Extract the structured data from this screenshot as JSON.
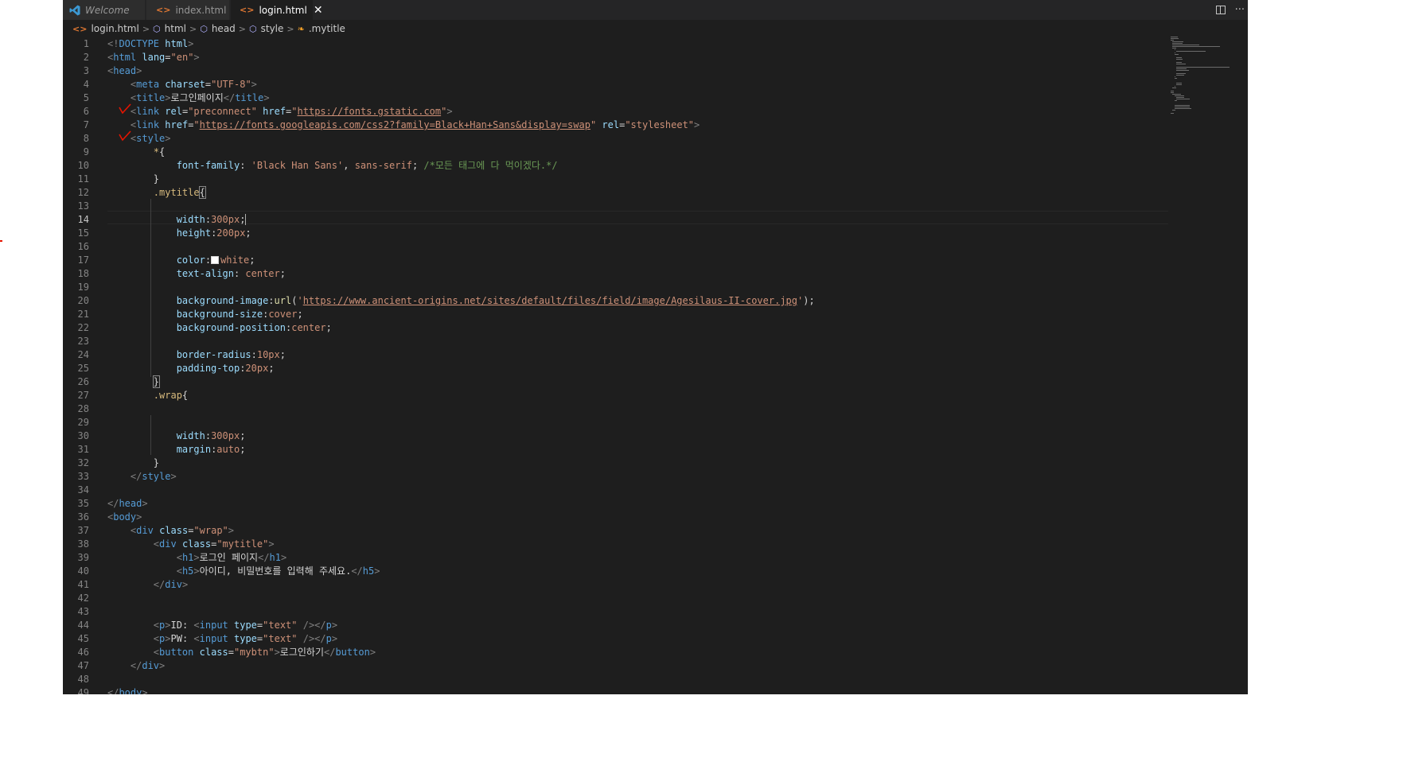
{
  "tabs": [
    {
      "label": "Welcome",
      "icon": "vscode-logo-icon",
      "active": false,
      "italic": true
    },
    {
      "label": "index.html",
      "icon": "html-file-icon",
      "active": false,
      "italic": false
    },
    {
      "label": "login.html",
      "icon": "html-file-icon",
      "active": true,
      "italic": false,
      "close": "✕"
    }
  ],
  "tab_actions": {
    "more": "···"
  },
  "breadcrumb": [
    "login.html",
    "html",
    "head",
    "style",
    ".mytitle"
  ],
  "colors": {
    "editor_bg": "#1e1e1e",
    "tab_bg": "#2d2d2d",
    "tag": "#569cd6",
    "attr": "#9cdcfe",
    "string": "#ce9178",
    "selector": "#d7ba7d",
    "comment": "#6a9955",
    "line_number": "#858585",
    "annotation_red": "#e51400"
  },
  "editor": {
    "active_line": 14,
    "annotated_lines": [
      6,
      8
    ],
    "lines": [
      [
        [
          "pun",
          "<!"
        ],
        [
          "tag",
          "DOCTYPE"
        ],
        [
          "text",
          " "
        ],
        [
          "attr",
          "html"
        ],
        [
          "pun",
          ">"
        ]
      ],
      [
        [
          "pun",
          "<"
        ],
        [
          "tag",
          "html"
        ],
        [
          "text",
          " "
        ],
        [
          "attr",
          "lang"
        ],
        [
          "text",
          "="
        ],
        [
          "str",
          "\"en\""
        ],
        [
          "pun",
          ">"
        ]
      ],
      [
        [
          "pun",
          "<"
        ],
        [
          "tag",
          "head"
        ],
        [
          "pun",
          ">"
        ]
      ],
      [
        [
          "text",
          "    "
        ],
        [
          "pun",
          "<"
        ],
        [
          "tag",
          "meta"
        ],
        [
          "text",
          " "
        ],
        [
          "attr",
          "charset"
        ],
        [
          "text",
          "="
        ],
        [
          "str",
          "\"UTF-8\""
        ],
        [
          "pun",
          ">"
        ]
      ],
      [
        [
          "text",
          "    "
        ],
        [
          "pun",
          "<"
        ],
        [
          "tag",
          "title"
        ],
        [
          "pun",
          ">"
        ],
        [
          "text",
          "로그인페이지"
        ],
        [
          "pun",
          "</"
        ],
        [
          "tag",
          "title"
        ],
        [
          "pun",
          ">"
        ]
      ],
      [
        [
          "text",
          "    "
        ],
        [
          "pun",
          "<"
        ],
        [
          "tag",
          "link"
        ],
        [
          "text",
          " "
        ],
        [
          "attr",
          "rel"
        ],
        [
          "text",
          "="
        ],
        [
          "str",
          "\"preconnect\""
        ],
        [
          "text",
          " "
        ],
        [
          "attr",
          "href"
        ],
        [
          "text",
          "="
        ],
        [
          "str",
          "\""
        ],
        [
          "url",
          "https://fonts.gstatic.com"
        ],
        [
          "str",
          "\""
        ],
        [
          "pun",
          ">"
        ]
      ],
      [
        [
          "text",
          "    "
        ],
        [
          "pun",
          "<"
        ],
        [
          "tag",
          "link"
        ],
        [
          "text",
          " "
        ],
        [
          "attr",
          "href"
        ],
        [
          "text",
          "="
        ],
        [
          "str",
          "\""
        ],
        [
          "url",
          "https://fonts.googleapis.com/css2?family=Black+Han+Sans&display=swap"
        ],
        [
          "str",
          "\""
        ],
        [
          "text",
          " "
        ],
        [
          "attr",
          "rel"
        ],
        [
          "text",
          "="
        ],
        [
          "str",
          "\"stylesheet\""
        ],
        [
          "pun",
          ">"
        ]
      ],
      [
        [
          "text",
          "    "
        ],
        [
          "pun",
          "<"
        ],
        [
          "tag",
          "style"
        ],
        [
          "pun",
          ">"
        ]
      ],
      [
        [
          "text",
          "        "
        ],
        [
          "sel",
          "*"
        ],
        [
          "text",
          "{"
        ]
      ],
      [
        [
          "text",
          "            "
        ],
        [
          "attr",
          "font-family"
        ],
        [
          "text",
          ": "
        ],
        [
          "str",
          "'Black Han Sans'"
        ],
        [
          "text",
          ", "
        ],
        [
          "str",
          "sans-serif"
        ],
        [
          "text",
          "; "
        ],
        [
          "cmt",
          "/*모든 태그에 다 먹이겠다.*/"
        ]
      ],
      [
        [
          "text",
          "        }"
        ]
      ],
      [
        [
          "text",
          "        "
        ],
        [
          "sel",
          ".mytitle"
        ],
        [
          "brace",
          "{"
        ]
      ],
      [],
      [
        [
          "text",
          "            "
        ],
        [
          "attr",
          "width"
        ],
        [
          "text",
          ":"
        ],
        [
          "str",
          "300px"
        ],
        [
          "text",
          ";"
        ],
        [
          "caret",
          ""
        ]
      ],
      [
        [
          "text",
          "            "
        ],
        [
          "attr",
          "height"
        ],
        [
          "text",
          ":"
        ],
        [
          "str",
          "200px"
        ],
        [
          "text",
          ";"
        ]
      ],
      [],
      [
        [
          "text",
          "            "
        ],
        [
          "attr",
          "color"
        ],
        [
          "text",
          ":"
        ],
        [
          "swatch",
          ""
        ],
        [
          "str",
          "white"
        ],
        [
          "text",
          ";"
        ]
      ],
      [
        [
          "text",
          "            "
        ],
        [
          "attr",
          "text-align"
        ],
        [
          "text",
          ": "
        ],
        [
          "str",
          "center"
        ],
        [
          "text",
          ";"
        ]
      ],
      [],
      [
        [
          "text",
          "            "
        ],
        [
          "attr",
          "background-image"
        ],
        [
          "text",
          ":"
        ],
        [
          "fn",
          "url"
        ],
        [
          "text",
          "("
        ],
        [
          "str",
          "'"
        ],
        [
          "url",
          "https://www.ancient-origins.net/sites/default/files/field/image/Agesilaus-II-cover.jpg"
        ],
        [
          "str",
          "'"
        ],
        [
          "text",
          ");"
        ]
      ],
      [
        [
          "text",
          "            "
        ],
        [
          "attr",
          "background-size"
        ],
        [
          "text",
          ":"
        ],
        [
          "str",
          "cover"
        ],
        [
          "text",
          ";"
        ]
      ],
      [
        [
          "text",
          "            "
        ],
        [
          "attr",
          "background-position"
        ],
        [
          "text",
          ":"
        ],
        [
          "str",
          "center"
        ],
        [
          "text",
          ";"
        ]
      ],
      [],
      [
        [
          "text",
          "            "
        ],
        [
          "attr",
          "border-radius"
        ],
        [
          "text",
          ":"
        ],
        [
          "str",
          "10px"
        ],
        [
          "text",
          ";"
        ]
      ],
      [
        [
          "text",
          "            "
        ],
        [
          "attr",
          "padding-top"
        ],
        [
          "text",
          ":"
        ],
        [
          "str",
          "20px"
        ],
        [
          "text",
          ";"
        ]
      ],
      [
        [
          "text",
          "        "
        ],
        [
          "brace",
          "}"
        ]
      ],
      [
        [
          "text",
          "        "
        ],
        [
          "sel",
          ".wrap"
        ],
        [
          "text",
          "{"
        ]
      ],
      [],
      [],
      [
        [
          "text",
          "            "
        ],
        [
          "attr",
          "width"
        ],
        [
          "text",
          ":"
        ],
        [
          "str",
          "300px"
        ],
        [
          "text",
          ";"
        ]
      ],
      [
        [
          "text",
          "            "
        ],
        [
          "attr",
          "margin"
        ],
        [
          "text",
          ":"
        ],
        [
          "str",
          "auto"
        ],
        [
          "text",
          ";"
        ]
      ],
      [
        [
          "text",
          "        }"
        ]
      ],
      [
        [
          "text",
          "    "
        ],
        [
          "pun",
          "</"
        ],
        [
          "tag",
          "style"
        ],
        [
          "pun",
          ">"
        ]
      ],
      [],
      [
        [
          "pun",
          "</"
        ],
        [
          "tag",
          "head"
        ],
        [
          "pun",
          ">"
        ]
      ],
      [
        [
          "pun",
          "<"
        ],
        [
          "tag",
          "body"
        ],
        [
          "pun",
          ">"
        ]
      ],
      [
        [
          "text",
          "    "
        ],
        [
          "pun",
          "<"
        ],
        [
          "tag",
          "div"
        ],
        [
          "text",
          " "
        ],
        [
          "attr",
          "class"
        ],
        [
          "text",
          "="
        ],
        [
          "str",
          "\"wrap\""
        ],
        [
          "pun",
          ">"
        ]
      ],
      [
        [
          "text",
          "        "
        ],
        [
          "pun",
          "<"
        ],
        [
          "tag",
          "div"
        ],
        [
          "text",
          " "
        ],
        [
          "attr",
          "class"
        ],
        [
          "text",
          "="
        ],
        [
          "str",
          "\"mytitle\""
        ],
        [
          "pun",
          ">"
        ]
      ],
      [
        [
          "text",
          "            "
        ],
        [
          "pun",
          "<"
        ],
        [
          "tag",
          "h1"
        ],
        [
          "pun",
          ">"
        ],
        [
          "text",
          "로그인 페이지"
        ],
        [
          "pun",
          "</"
        ],
        [
          "tag",
          "h1"
        ],
        [
          "pun",
          ">"
        ]
      ],
      [
        [
          "text",
          "            "
        ],
        [
          "pun",
          "<"
        ],
        [
          "tag",
          "h5"
        ],
        [
          "pun",
          ">"
        ],
        [
          "text",
          "아이디, 비밀번호를 입력해 주세요."
        ],
        [
          "pun",
          "</"
        ],
        [
          "tag",
          "h5"
        ],
        [
          "pun",
          ">"
        ]
      ],
      [
        [
          "text",
          "        "
        ],
        [
          "pun",
          "</"
        ],
        [
          "tag",
          "div"
        ],
        [
          "pun",
          ">"
        ]
      ],
      [],
      [],
      [
        [
          "text",
          "        "
        ],
        [
          "pun",
          "<"
        ],
        [
          "tag",
          "p"
        ],
        [
          "pun",
          ">"
        ],
        [
          "text",
          "ID: "
        ],
        [
          "pun",
          "<"
        ],
        [
          "tag",
          "input"
        ],
        [
          "text",
          " "
        ],
        [
          "attr",
          "type"
        ],
        [
          "text",
          "="
        ],
        [
          "str",
          "\"text\""
        ],
        [
          "text",
          " "
        ],
        [
          "pun",
          "/></"
        ],
        [
          "tag",
          "p"
        ],
        [
          "pun",
          ">"
        ]
      ],
      [
        [
          "text",
          "        "
        ],
        [
          "pun",
          "<"
        ],
        [
          "tag",
          "p"
        ],
        [
          "pun",
          ">"
        ],
        [
          "text",
          "PW: "
        ],
        [
          "pun",
          "<"
        ],
        [
          "tag",
          "input"
        ],
        [
          "text",
          " "
        ],
        [
          "attr",
          "type"
        ],
        [
          "text",
          "="
        ],
        [
          "str",
          "\"text\""
        ],
        [
          "text",
          " "
        ],
        [
          "pun",
          "/></"
        ],
        [
          "tag",
          "p"
        ],
        [
          "pun",
          ">"
        ]
      ],
      [
        [
          "text",
          "        "
        ],
        [
          "pun",
          "<"
        ],
        [
          "tag",
          "button"
        ],
        [
          "text",
          " "
        ],
        [
          "attr",
          "class"
        ],
        [
          "text",
          "="
        ],
        [
          "str",
          "\"mybtn\""
        ],
        [
          "pun",
          ">"
        ],
        [
          "text",
          "로그인하기"
        ],
        [
          "pun",
          "</"
        ],
        [
          "tag",
          "button"
        ],
        [
          "pun",
          ">"
        ]
      ],
      [
        [
          "text",
          "    "
        ],
        [
          "pun",
          "</"
        ],
        [
          "tag",
          "div"
        ],
        [
          "pun",
          ">"
        ]
      ],
      [],
      [
        [
          "pun",
          "</"
        ],
        [
          "tag",
          "body"
        ],
        [
          "pun",
          ">"
        ]
      ]
    ]
  }
}
